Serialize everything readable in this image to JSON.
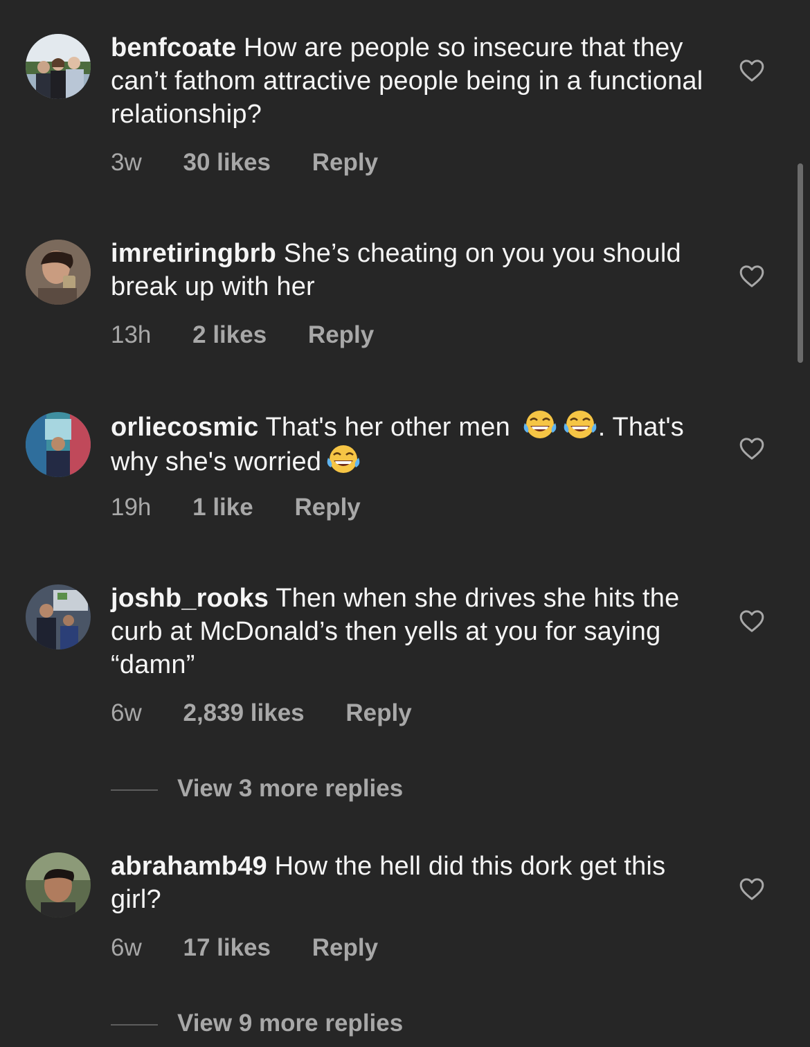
{
  "comments": [
    {
      "username": "benfcoate",
      "text": " How are people so insecure that they can’t fathom attractive people being in a functional relationship?",
      "time": "3w",
      "likes": "30 likes",
      "reply": "Reply"
    },
    {
      "username": "imretiringbrb",
      "text": " She’s cheating on you you should break up with her",
      "time": "13h",
      "likes": "2 likes",
      "reply": "Reply"
    },
    {
      "username": "orliecosmic",
      "text_part1": " That's her other men ",
      "text_part2": ". That's why she's worried",
      "time": "19h",
      "likes": "1 like",
      "reply": "Reply"
    },
    {
      "username": "joshb_rooks",
      "text": " Then when she drives she hits the curb at McDonald’s then yells at you for saying “damn”",
      "time": "6w",
      "likes": "2,839 likes",
      "reply": "Reply",
      "view_replies": "View 3 more replies"
    },
    {
      "username": "abrahamb49",
      "text": " How the hell did this dork get this girl?",
      "time": "6w",
      "likes": "17 likes",
      "reply": "Reply",
      "view_replies": "View 9 more replies"
    }
  ],
  "icons": {
    "like": "heart-outline-icon",
    "emoji": "face-with-tears-of-joy-emoji"
  },
  "colors": {
    "background": "#262626",
    "primary_text": "#f5f5f5",
    "secondary_text": "#a8a8a8"
  }
}
